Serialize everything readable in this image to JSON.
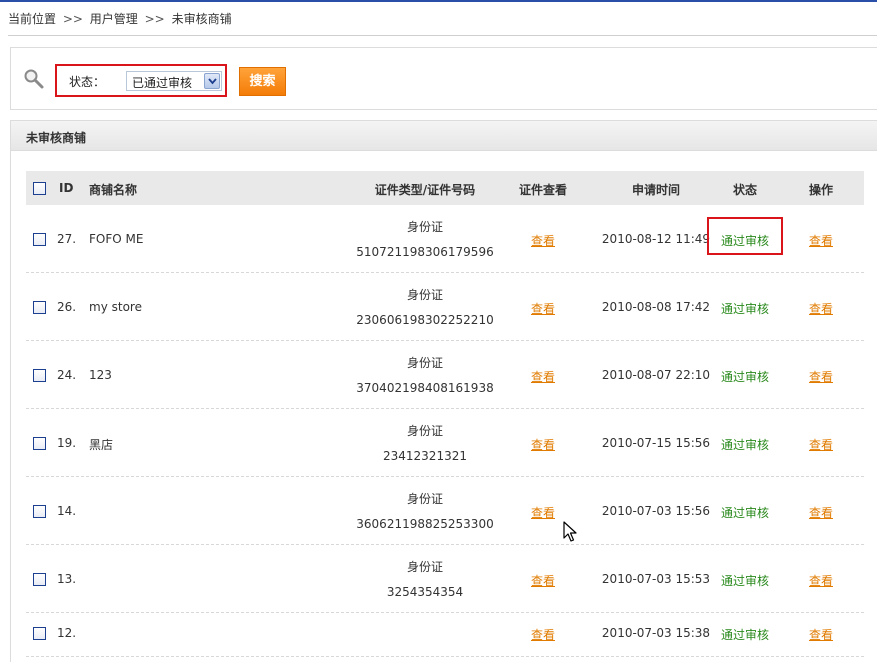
{
  "breadcrumb": {
    "label": "当前位置",
    "separator": ">>",
    "items": [
      "用户管理",
      "未审核商铺"
    ]
  },
  "search": {
    "icon": "magnifier-icon",
    "status_label": "状态：",
    "status_value": "已通过审核",
    "button_label": "搜索"
  },
  "panel": {
    "title": "未审核商铺"
  },
  "table": {
    "headers": {
      "id": "ID",
      "name": "商铺名称",
      "cert": "证件类型/证件号码",
      "cert_view": "证件查看",
      "time": "申请时间",
      "status": "状态",
      "action": "操作"
    },
    "rows": [
      {
        "id": "27.",
        "name": "FOFO ME",
        "cert_type": "身份证",
        "cert_no": "510721198306179596",
        "cert_view": "查看",
        "time": "2010-08-12 11:49",
        "status": "通过审核",
        "action": "查看"
      },
      {
        "id": "26.",
        "name": "my store",
        "cert_type": "身份证",
        "cert_no": "230606198302252210",
        "cert_view": "查看",
        "time": "2010-08-08 17:42",
        "status": "通过审核",
        "action": "查看"
      },
      {
        "id": "24.",
        "name": "123",
        "cert_type": "身份证",
        "cert_no": "370402198408161938",
        "cert_view": "查看",
        "time": "2010-08-07 22:10",
        "status": "通过审核",
        "action": "查看"
      },
      {
        "id": "19.",
        "name": "黑店",
        "cert_type": "身份证",
        "cert_no": "23412321321",
        "cert_view": "查看",
        "time": "2010-07-15 15:56",
        "status": "通过审核",
        "action": "查看"
      },
      {
        "id": "14.",
        "name": "",
        "cert_type": "身份证",
        "cert_no": "360621198825253300",
        "cert_view": "查看",
        "time": "2010-07-03 15:56",
        "status": "通过审核",
        "action": "查看"
      },
      {
        "id": "13.",
        "name": "",
        "cert_type": "身份证",
        "cert_no": "3254354354",
        "cert_view": "查看",
        "time": "2010-07-03 15:53",
        "status": "通过审核",
        "action": "查看"
      },
      {
        "id": "12.",
        "name": "",
        "cert_type": "",
        "cert_no": "",
        "cert_view": "查看",
        "time": "2010-07-03 15:38",
        "status": "通过审核",
        "action": "查看"
      }
    ]
  },
  "colors": {
    "accent_orange": "#f47c07",
    "link": "#e07b00",
    "status_green": "#2a8a1d",
    "highlight_red": "#d9141b",
    "nav_blue": "#2a4fa8"
  }
}
